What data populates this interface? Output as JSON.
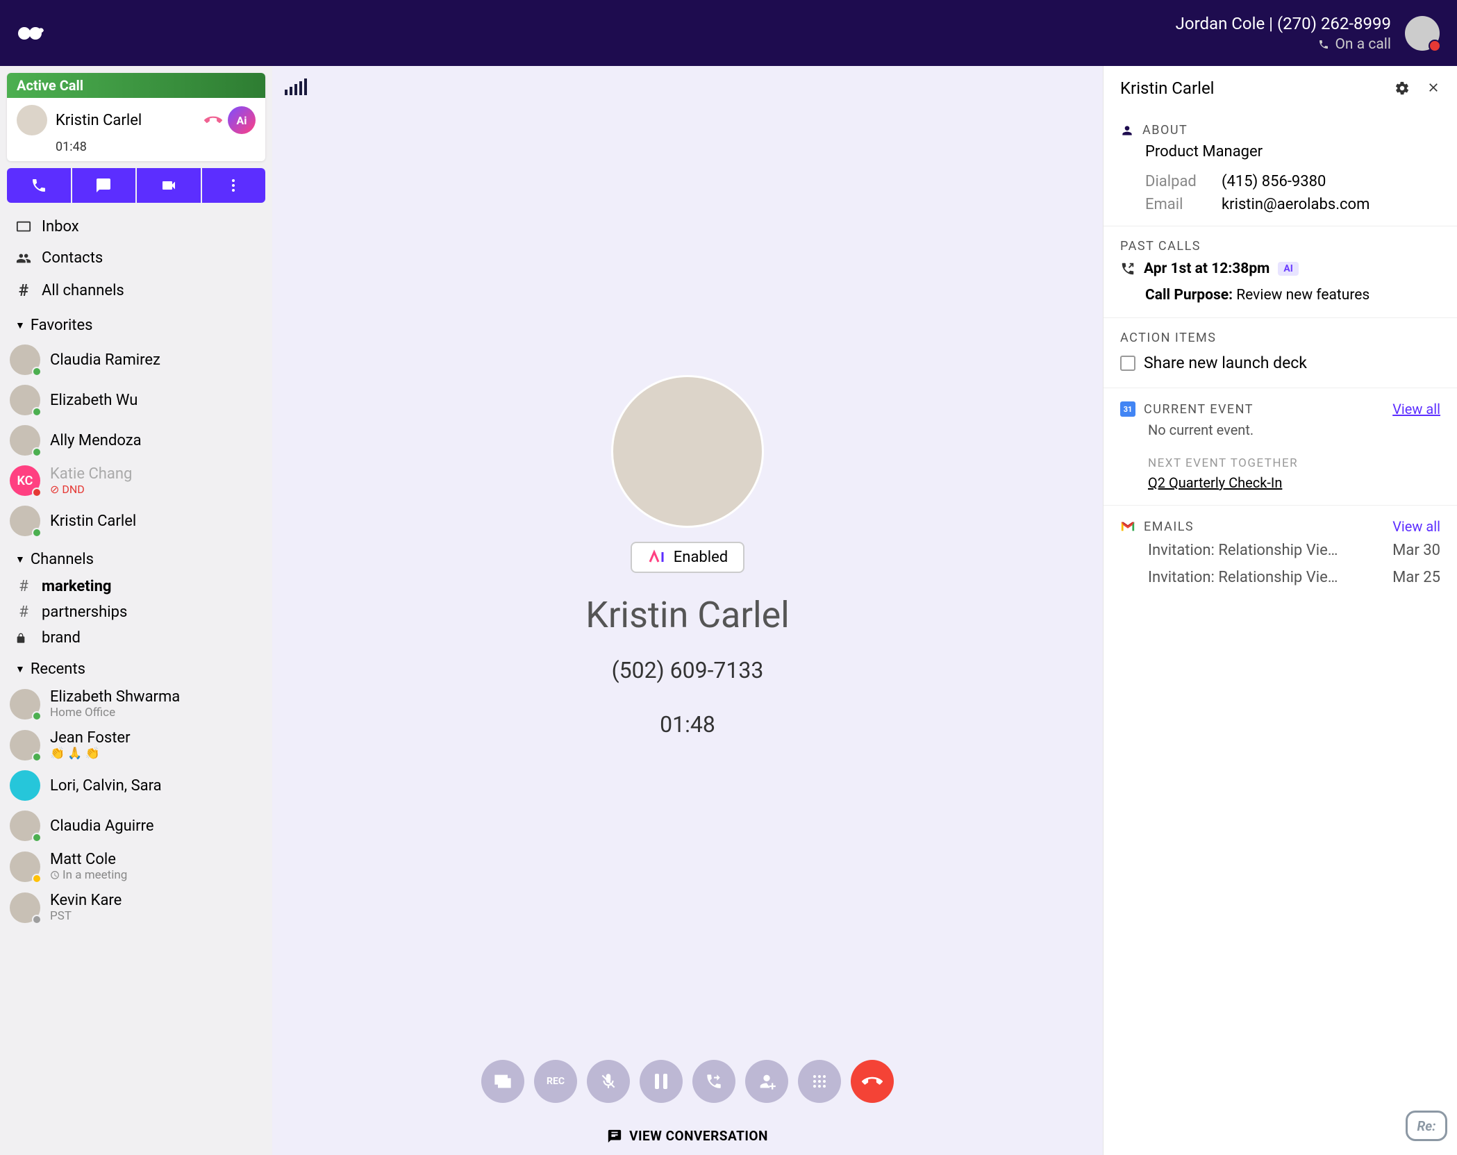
{
  "topbar": {
    "user_name": "Jordan Cole",
    "user_phone": "(270) 262-8999",
    "status": "On a call"
  },
  "active_call": {
    "header": "Active Call",
    "name": "Kristin Carlel",
    "timer": "01:48",
    "ai_badge": "Ai"
  },
  "nav": {
    "inbox": "Inbox",
    "contacts": "Contacts",
    "all_channels": "All channels"
  },
  "favorites": {
    "header": "Favorites",
    "items": [
      {
        "name": "Claudia Ramirez",
        "status": "green"
      },
      {
        "name": "Elizabeth Wu",
        "status": "green"
      },
      {
        "name": "Ally Mendoza",
        "status": "green"
      },
      {
        "name": "Katie Chang",
        "status": "red",
        "dnd": "DND",
        "initials": "KC"
      },
      {
        "name": "Kristin Carlel",
        "status": "green"
      }
    ]
  },
  "channels": {
    "header": "Channels",
    "items": [
      {
        "name": "marketing",
        "bold": true,
        "icon": "#"
      },
      {
        "name": "partnerships",
        "icon": "#"
      },
      {
        "name": "brand",
        "icon": "lock"
      }
    ]
  },
  "recents": {
    "header": "Recents",
    "items": [
      {
        "name": "Elizabeth Shwarma",
        "sub": "Home Office",
        "status": "green"
      },
      {
        "name": "Jean Foster",
        "sub": "👏 🙏 👏",
        "status": "green"
      },
      {
        "name": "Lori, Calvin, Sara",
        "group": true
      },
      {
        "name": "Claudia Aguirre",
        "status": "green"
      },
      {
        "name": "Matt Cole",
        "sub": "In a meeting",
        "sub_icon": "clock",
        "status": "yellow"
      },
      {
        "name": "Kevin Kare",
        "sub": "PST",
        "status": "gray"
      }
    ]
  },
  "call": {
    "enabled_badge": "Enabled",
    "name": "Kristin Carlel",
    "phone": "(502) 609-7133",
    "timer": "01:48",
    "view_conv": "VIEW CONVERSATION",
    "controls": {
      "rec": "REC"
    }
  },
  "details": {
    "title": "Kristin Carlel",
    "about": {
      "header": "ABOUT",
      "job": "Product Manager",
      "dialpad_label": "Dialpad",
      "dialpad_value": "(415) 856-9380",
      "email_label": "Email",
      "email_value": "kristin@aerolabs.com"
    },
    "past_calls": {
      "header": "PAST CALLS",
      "time": "Apr 1st at 12:38pm",
      "ai_pill": "AI",
      "purpose_label": "Call Purpose:",
      "purpose_value": "Review new features"
    },
    "action_items": {
      "header": "ACTION ITEMS",
      "item": "Share new launch deck"
    },
    "events": {
      "cal_icon_text": "31",
      "header": "CURRENT EVENT",
      "view_all": "View all",
      "no_event": "No current event.",
      "next_header": "NEXT EVENT TOGETHER",
      "next_event": "Q2 Quarterly Check-In"
    },
    "emails": {
      "header": "EMAILS",
      "view_all": "View all",
      "items": [
        {
          "subject": "Invitation: Relationship Vie…",
          "date": "Mar 30"
        },
        {
          "subject": "Invitation: Relationship Vie…",
          "date": "Mar 25"
        }
      ]
    }
  },
  "re_badge": "Re:"
}
